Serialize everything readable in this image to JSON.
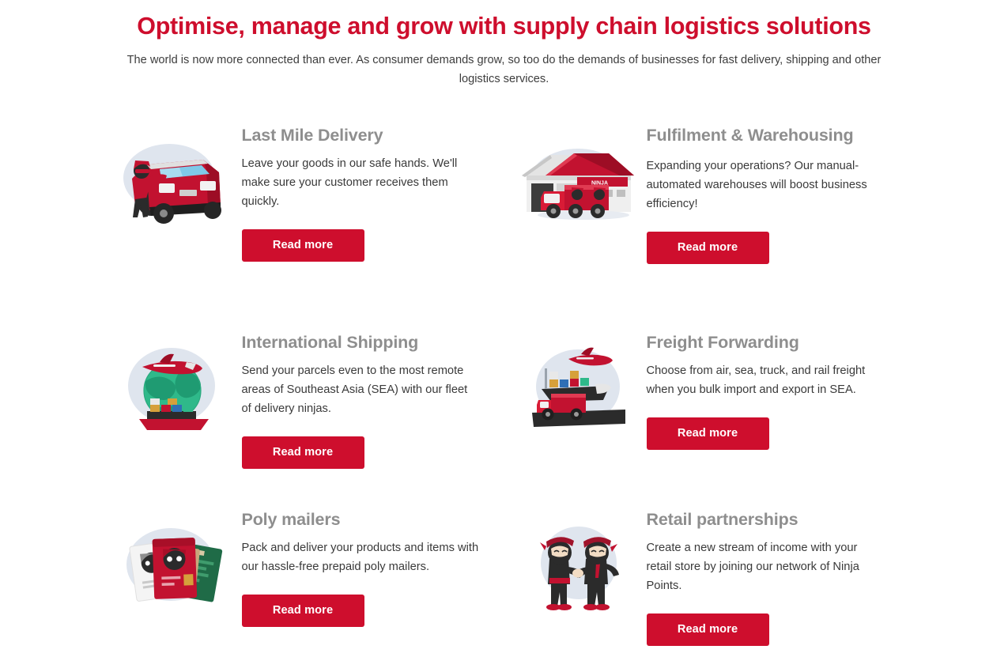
{
  "header": {
    "title": "Optimise, manage and grow with supply chain logistics solutions",
    "subtitle": "The world is now more connected than ever. As consumer demands grow, so too do the demands of businesses for fast delivery, shipping and other logistics services."
  },
  "theme": {
    "brand_red": "#CE0E2D",
    "heading_gray": "#8e8e8e",
    "body_text": "#3a3a3a",
    "blob_blue": "#dfe5ee",
    "background": "#ffffff"
  },
  "cards": [
    {
      "id": "last-mile-delivery",
      "icon": "delivery-van-illustration",
      "title": "Last Mile Delivery",
      "description": "Leave your goods in our safe hands. We'll make sure your customer receives them quickly.",
      "cta_label": "Read more"
    },
    {
      "id": "fulfilment-warehousing",
      "icon": "warehouse-truck-illustration",
      "title": "Fulfilment & Warehousing",
      "description": "Expanding your operations? Our manual-automated warehouses will boost business efficiency!",
      "cta_label": "Read more"
    },
    {
      "id": "international-shipping",
      "icon": "globe-plane-ship-illustration",
      "title": "International Shipping",
      "description": "Send your parcels even to the most remote areas of Southeast Asia (SEA) with our fleet of delivery ninjas.",
      "cta_label": "Read more"
    },
    {
      "id": "freight-forwarding",
      "icon": "plane-cargoship-truck-illustration",
      "title": "Freight Forwarding",
      "description": "Choose from air, sea, truck, and rail freight when you bulk import and export in SEA.",
      "cta_label": "Read more"
    },
    {
      "id": "poly-mailers",
      "icon": "poly-mailer-bags-illustration",
      "title": "Poly mailers",
      "description": "Pack and deliver your products and items with our hassle-free prepaid poly mailers.",
      "cta_label": "Read more"
    },
    {
      "id": "retail-partnerships",
      "icon": "two-ninjas-handshake-illustration",
      "title": "Retail partnerships",
      "description": "Create a new stream of income with your retail store by joining our network of Ninja Points.",
      "cta_label": "Read more"
    }
  ]
}
